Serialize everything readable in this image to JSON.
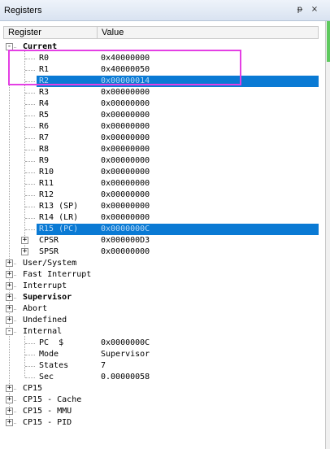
{
  "window": {
    "title": "Registers",
    "pin_glyph": "ᵽ",
    "close_glyph": "×"
  },
  "columns": {
    "register": "Register",
    "value": "Value"
  },
  "rows": [
    {
      "name": "Current",
      "value": "",
      "level": 0,
      "toggle": "-",
      "bold": true
    },
    {
      "name": "R0",
      "value": "0x40000000",
      "level": 1
    },
    {
      "name": "R1",
      "value": "0x40000050",
      "level": 1
    },
    {
      "name": "R2",
      "value": "0x00000014",
      "level": 1,
      "selected": true
    },
    {
      "name": "R3",
      "value": "0x00000000",
      "level": 1
    },
    {
      "name": "R4",
      "value": "0x00000000",
      "level": 1
    },
    {
      "name": "R5",
      "value": "0x00000000",
      "level": 1
    },
    {
      "name": "R6",
      "value": "0x00000000",
      "level": 1
    },
    {
      "name": "R7",
      "value": "0x00000000",
      "level": 1
    },
    {
      "name": "R8",
      "value": "0x00000000",
      "level": 1
    },
    {
      "name": "R9",
      "value": "0x00000000",
      "level": 1
    },
    {
      "name": "R10",
      "value": "0x00000000",
      "level": 1
    },
    {
      "name": "R11",
      "value": "0x00000000",
      "level": 1
    },
    {
      "name": "R12",
      "value": "0x00000000",
      "level": 1
    },
    {
      "name": "R13 (SP)",
      "value": "0x00000000",
      "level": 1
    },
    {
      "name": "R14 (LR)",
      "value": "0x00000000",
      "level": 1
    },
    {
      "name": "R15 (PC)",
      "value": "0x0000000C",
      "level": 1,
      "selected": true
    },
    {
      "name": "CPSR",
      "value": "0x000000D3",
      "level": 1,
      "toggle": "+"
    },
    {
      "name": "SPSR",
      "value": "0x00000000",
      "level": 1,
      "toggle": "+"
    },
    {
      "name": "User/System",
      "value": "",
      "level": 0,
      "toggle": "+"
    },
    {
      "name": "Fast Interrupt",
      "value": "",
      "level": 0,
      "toggle": "+"
    },
    {
      "name": "Interrupt",
      "value": "",
      "level": 0,
      "toggle": "+"
    },
    {
      "name": "Supervisor",
      "value": "",
      "level": 0,
      "toggle": "+",
      "bold": true
    },
    {
      "name": "Abort",
      "value": "",
      "level": 0,
      "toggle": "+"
    },
    {
      "name": "Undefined",
      "value": "",
      "level": 0,
      "toggle": "+"
    },
    {
      "name": "Internal",
      "value": "",
      "level": 0,
      "toggle": "-"
    },
    {
      "name": "PC  $",
      "value": "0x0000000C",
      "level": 1
    },
    {
      "name": "Mode",
      "value": "Supervisor",
      "level": 1
    },
    {
      "name": "States",
      "value": "7",
      "level": 1
    },
    {
      "name": "Sec",
      "value": "0.00000058",
      "level": 1
    },
    {
      "name": "CP15",
      "value": "",
      "level": 0,
      "toggle": "+"
    },
    {
      "name": "CP15 - Cache",
      "value": "",
      "level": 0,
      "toggle": "+"
    },
    {
      "name": "CP15 - MMU",
      "value": "",
      "level": 0,
      "toggle": "+"
    },
    {
      "name": "CP15 - PID",
      "value": "",
      "level": 0,
      "toggle": "+"
    }
  ],
  "colors": {
    "selection": "#0a7ad4",
    "annotation": "#e43fe4"
  }
}
